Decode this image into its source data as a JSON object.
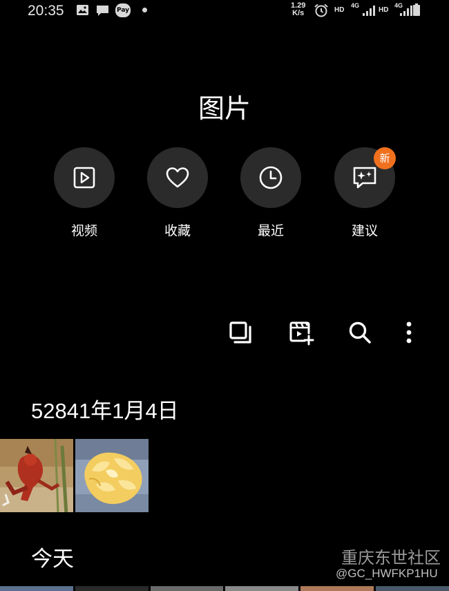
{
  "status_bar": {
    "time": "20:35",
    "speed_value": "1.29",
    "speed_unit": "K/s",
    "net1_hd": "HD",
    "net1_gen": "4G",
    "net2_hd": "HD",
    "net2_gen": "4G",
    "icons": [
      "gallery-icon",
      "message-icon",
      "pay-icon",
      "dot-icon",
      "alarm-icon",
      "signal-icon",
      "battery-icon"
    ],
    "pay_label": "Pay"
  },
  "header": {
    "title": "图片"
  },
  "quick_actions": [
    {
      "label": "视频",
      "icon": "video-play-icon"
    },
    {
      "label": "收藏",
      "icon": "heart-icon"
    },
    {
      "label": "最近",
      "icon": "clock-icon"
    },
    {
      "label": "建议",
      "icon": "sparkle-chat-icon",
      "badge": "新"
    }
  ],
  "toolbar": {
    "icons": [
      "select-icon",
      "create-movie-icon",
      "search-icon",
      "more-options-icon"
    ]
  },
  "sections": [
    {
      "date": "52841年1月4日",
      "thumbnails": [
        {
          "icon": "photo-thumbnail"
        },
        {
          "icon": "photo-thumbnail"
        }
      ]
    },
    {
      "date": "今天"
    }
  ],
  "watermark": {
    "line1": "重庆东世社区",
    "line2": "@GC_HWFKP1HU"
  },
  "colors": {
    "background": "#000000",
    "circle": "#2b2b2b",
    "badge": "#f0701e"
  }
}
